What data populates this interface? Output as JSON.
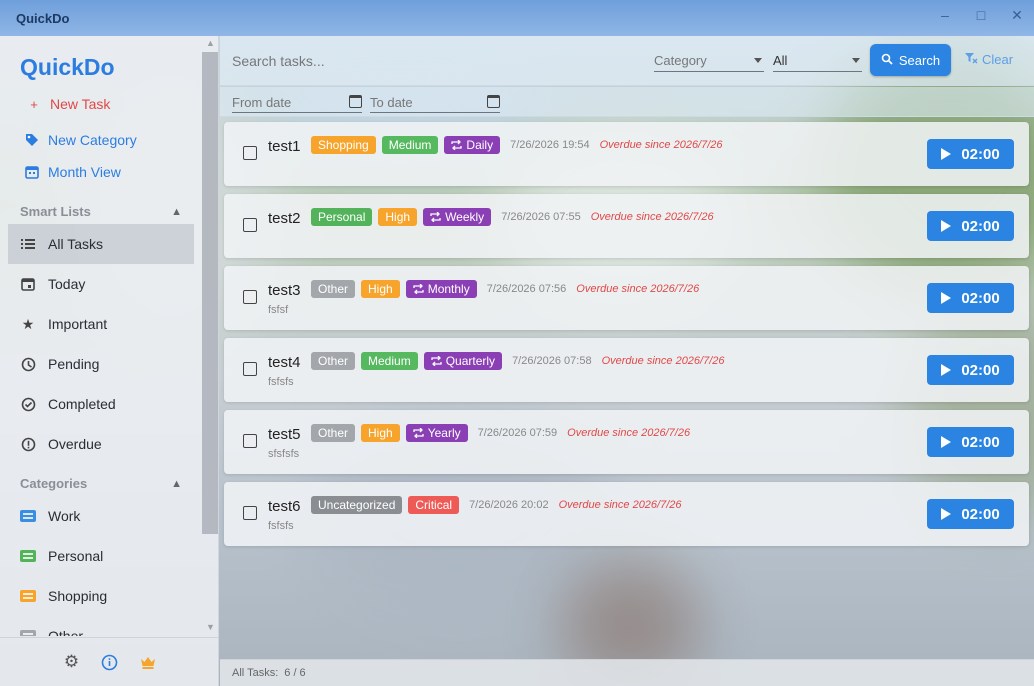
{
  "window": {
    "title": "QuickDo"
  },
  "sidebar": {
    "logo": "QuickDo",
    "new_task": "New Task",
    "new_category": "New Category",
    "month_view": "Month View",
    "smart_lists_title": "Smart Lists",
    "smart_lists": [
      {
        "label": "All Tasks",
        "icon": "list-icon",
        "active": true
      },
      {
        "label": "Today",
        "icon": "calendar-today-icon"
      },
      {
        "label": "Important",
        "icon": "star-icon"
      },
      {
        "label": "Pending",
        "icon": "clock-icon"
      },
      {
        "label": "Completed",
        "icon": "check-circle-icon"
      },
      {
        "label": "Overdue",
        "icon": "alert-circle-icon"
      }
    ],
    "categories_title": "Categories",
    "categories": [
      {
        "label": "Work",
        "color": "#3b8de0"
      },
      {
        "label": "Personal",
        "color": "#53b35b"
      },
      {
        "label": "Shopping",
        "color": "#f6a42c"
      },
      {
        "label": "Other",
        "color": "#a3a6aa"
      }
    ]
  },
  "toolbar": {
    "search_placeholder": "Search tasks...",
    "category_placeholder": "Category",
    "filter_value": "All",
    "search_label": "Search",
    "clear_label": "Clear"
  },
  "datebar": {
    "from_placeholder": "From date",
    "to_placeholder": "To date"
  },
  "tasks": [
    {
      "name": "test1",
      "desc": "",
      "category": "Shopping",
      "priority": "Medium",
      "repeat": "Daily",
      "date": "7/26/2026 19:54",
      "overdue": "Overdue since 2026/7/26",
      "timer": "02:00"
    },
    {
      "name": "test2",
      "desc": "",
      "category": "Personal",
      "priority": "High",
      "repeat": "Weekly",
      "date": "7/26/2026 07:55",
      "overdue": "Overdue since 2026/7/26",
      "timer": "02:00"
    },
    {
      "name": "test3",
      "desc": "fsfsf",
      "category": "Other",
      "priority": "High",
      "repeat": "Monthly",
      "date": "7/26/2026 07:56",
      "overdue": "Overdue since 2026/7/26",
      "timer": "02:00"
    },
    {
      "name": "test4",
      "desc": "fsfsfs",
      "category": "Other",
      "priority": "Medium",
      "repeat": "Quarterly",
      "date": "7/26/2026 07:58",
      "overdue": "Overdue since 2026/7/26",
      "timer": "02:00"
    },
    {
      "name": "test5",
      "desc": "sfsfsfs",
      "category": "Other",
      "priority": "High",
      "repeat": "Yearly",
      "date": "7/26/2026 07:59",
      "overdue": "Overdue since 2026/7/26",
      "timer": "02:00"
    },
    {
      "name": "test6",
      "desc": "fsfsfs",
      "category": "Uncategorized",
      "priority": "Critical",
      "repeat": "",
      "date": "7/26/2026 20:02",
      "overdue": "Overdue since 2026/7/26",
      "timer": "02:00"
    }
  ],
  "status": {
    "label": "All Tasks:",
    "count": "6 / 6"
  },
  "colors": {
    "accent": "#2b84e2",
    "danger": "#e04848",
    "repeat": "#8a3fb5"
  }
}
